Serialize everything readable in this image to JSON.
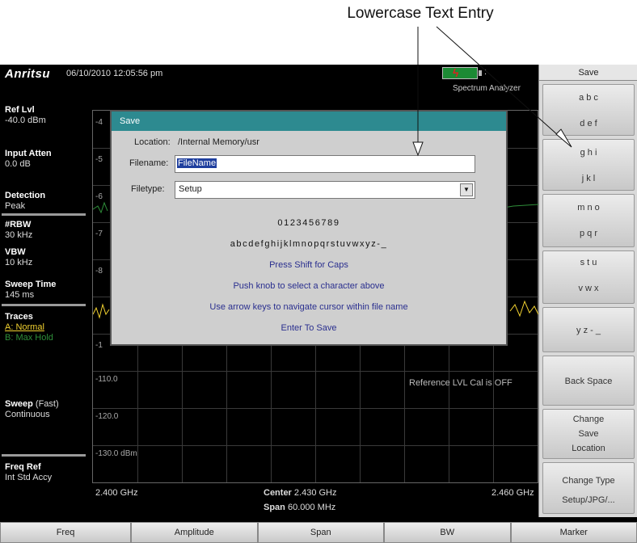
{
  "annotation": {
    "label": "Lowercase Text Entry"
  },
  "status": {
    "brand": "Anritsu",
    "datetime": "06/10/2010 12:05:56 pm",
    "battery_dots": ":",
    "mode": "Spectrum Analyzer"
  },
  "left_panel": [
    {
      "label": "Ref Lvl",
      "value": "-40.0 dBm"
    },
    {
      "label": "Input Atten",
      "value": "0.0 dB"
    },
    {
      "label": "Detection",
      "value": "Peak"
    },
    {
      "label": "#RBW",
      "value": "30 kHz"
    },
    {
      "label": "VBW",
      "value": "10 kHz"
    },
    {
      "label": "Sweep Time",
      "value": "145 ms"
    },
    {
      "label": "Traces",
      "value": "A: Normal",
      "value2": "B: Max Hold"
    },
    {
      "label": "Sweep",
      "label_suffix": " (Fast)",
      "value": "Continuous"
    },
    {
      "label": "Freq Ref",
      "value": "Int Std Accy"
    }
  ],
  "plot": {
    "y_labels": [
      "-4",
      "-5",
      "-6",
      "-7",
      "-8",
      "-1",
      "-110.0",
      "-120.0",
      "-130.0 dBm"
    ],
    "ref_cal": "Reference LVL Cal is OFF",
    "start": "2.400 GHz",
    "center_label": "Center",
    "center_value": "2.430 GHz",
    "span_label": "Span",
    "span_value": "60.000 MHz",
    "stop": "2.460 GHz"
  },
  "softkeys": {
    "title": "Save",
    "keys": [
      {
        "lines": [
          "a b c",
          "d e f"
        ]
      },
      {
        "lines": [
          "g h i",
          "j k l"
        ]
      },
      {
        "lines": [
          "m n o",
          "p q r"
        ]
      },
      {
        "lines": [
          "s t u",
          "v w x"
        ]
      },
      {
        "lines": [
          "y z - _"
        ]
      },
      {
        "lines": [
          "Back Space"
        ]
      },
      {
        "lines": [
          "Change",
          "Save",
          "Location"
        ]
      },
      {
        "lines": [
          "Change Type",
          "Setup/JPG/..."
        ]
      }
    ]
  },
  "bottom_menu": [
    "Freq",
    "Amplitude",
    "Span",
    "BW",
    "Marker"
  ],
  "dialog": {
    "title": "Save",
    "location_label": "Location:",
    "location_value": "/Internal Memory/usr",
    "filename_label": "Filename:",
    "filename_value": "FileName",
    "filetype_label": "Filetype:",
    "filetype_value": "Setup",
    "digits": "0123456789",
    "letters": "abcdefghijklmnopqrstuvwxyz-_",
    "hints": [
      "Press Shift for Caps",
      "Push knob to select a character above",
      "Use arrow keys to navigate cursor within file name",
      "Enter To Save"
    ]
  }
}
